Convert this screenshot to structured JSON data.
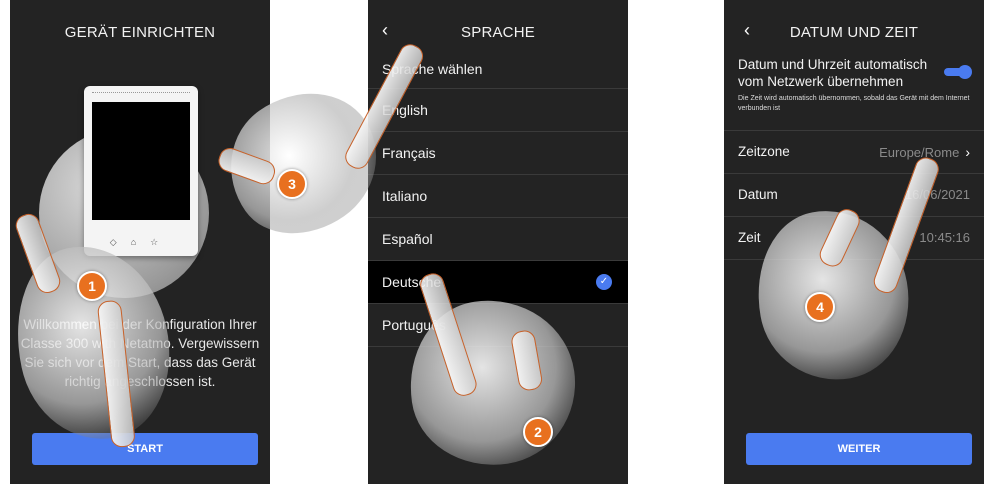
{
  "screen1": {
    "title": "GERÄT EINRICHTEN",
    "welcome": "Willkommen bei der Konfiguration Ihrer Classe 300 with Netatmo. Vergewissern Sie sich vor dem Start, dass das Gerät richtig angeschlossen ist.",
    "start_button": "START",
    "step": "1"
  },
  "screen2": {
    "back_icon": "‹",
    "title": "SPRACHE",
    "header": "Sprache wählen",
    "languages": [
      "English",
      "Français",
      "Italiano",
      "Español",
      "Deutsche",
      "Português"
    ],
    "selected": "Deutsche",
    "step_back": "3",
    "step_select": "2"
  },
  "screen3": {
    "back_icon": "‹",
    "title": "DATUM UND ZEIT",
    "auto_title": "Datum und Uhrzeit automatisch vom Netzwerk übernehmen",
    "auto_desc": "Die Zeit wird automatisch übernommen, sobald das Gerät mit dem Internet verbunden ist",
    "timezone_label": "Zeitzone",
    "timezone_value": "Europe/Rome",
    "date_label": "Datum",
    "date_value": "16/06/2021",
    "time_label": "Zeit",
    "time_value": "10:45:16",
    "next_button": "WEITER",
    "step": "4"
  },
  "colors": {
    "screen_bg": "#232323",
    "accent": "#4a7bf0",
    "step_marker": "#e8701f"
  }
}
